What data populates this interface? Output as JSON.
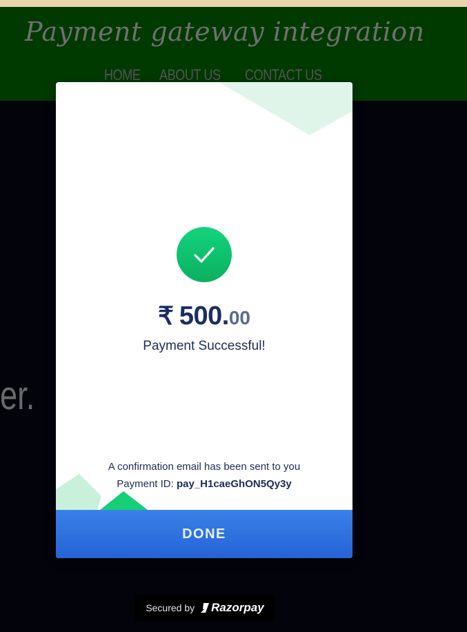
{
  "site": {
    "title": "Payment gateway integration",
    "nav": [
      "HOME",
      "ABOUT US",
      "CONTACT US"
    ],
    "background_text": "er."
  },
  "checkout": {
    "currency_symbol": "₹",
    "amount_whole": "500.",
    "amount_decimal": "00",
    "status_text": "Payment Successful!",
    "confirmation_text": "A confirmation email has been sent to you",
    "payment_id_label": "Payment ID:",
    "payment_id_value": "pay_H1caeGhON5Qy3y",
    "done_label": "DONE"
  },
  "footer": {
    "secured_by_text": "Secured by",
    "brand_name": "Razorpay"
  },
  "icons": {
    "status": "check-icon",
    "brand": "razorpay-logo-icon"
  },
  "colors": {
    "header_bg": "#013a01",
    "overlay_bg": "#03030c",
    "success_green": "#13d37e",
    "done_button_blue": "#2f73e0",
    "text_navy": "#1b2d63"
  }
}
